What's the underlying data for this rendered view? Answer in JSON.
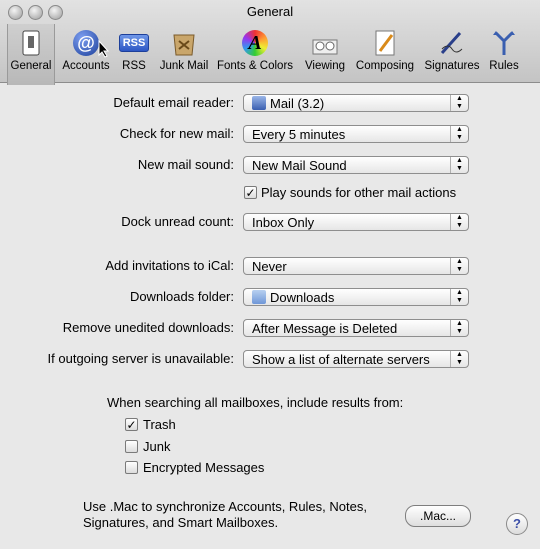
{
  "window": {
    "title": "General"
  },
  "toolbar": {
    "items": [
      {
        "label": "General",
        "icon": "switch-icon"
      },
      {
        "label": "Accounts",
        "icon": "at-icon"
      },
      {
        "label": "RSS",
        "icon": "rss-icon"
      },
      {
        "label": "Junk Mail",
        "icon": "junk-icon"
      },
      {
        "label": "Fonts & Colors",
        "icon": "fonts-icon"
      },
      {
        "label": "Viewing",
        "icon": "viewing-icon"
      },
      {
        "label": "Composing",
        "icon": "composing-icon"
      },
      {
        "label": "Signatures",
        "icon": "signatures-icon"
      },
      {
        "label": "Rules",
        "icon": "rules-icon"
      }
    ],
    "rss_badge": "RSS",
    "at_glyph": "@",
    "fonts_glyph": "A"
  },
  "settings": {
    "default_reader": {
      "label": "Default email reader:",
      "value": "Mail (3.2)"
    },
    "check_mail": {
      "label": "Check for new mail:",
      "value": "Every 5 minutes"
    },
    "mail_sound": {
      "label": "New mail sound:",
      "value": "New Mail Sound"
    },
    "play_sounds": {
      "label": "Play sounds for other mail actions",
      "checked": true
    },
    "dock_count": {
      "label": "Dock unread count:",
      "value": "Inbox Only"
    },
    "invitations": {
      "label": "Add invitations to iCal:",
      "value": "Never"
    },
    "downloads_folder": {
      "label": "Downloads folder:",
      "value": "Downloads"
    },
    "remove_downloads": {
      "label": "Remove unedited downloads:",
      "value": "After Message is Deleted"
    },
    "outgoing": {
      "label": "If outgoing server is unavailable:",
      "value": "Show a list of alternate servers"
    }
  },
  "search": {
    "heading": "When searching all mailboxes, include results from:",
    "options": [
      {
        "label": "Trash",
        "checked": true
      },
      {
        "label": "Junk",
        "checked": false
      },
      {
        "label": "Encrypted Messages",
        "checked": false
      }
    ]
  },
  "mac": {
    "text_line1": "Use .Mac to synchronize Accounts, Rules, Notes,",
    "text_line2": "Signatures, and Smart Mailboxes.",
    "button": ".Mac..."
  },
  "help": "?",
  "colors": {
    "accent": "#3c4fa8",
    "background": "#e8e8e8"
  }
}
